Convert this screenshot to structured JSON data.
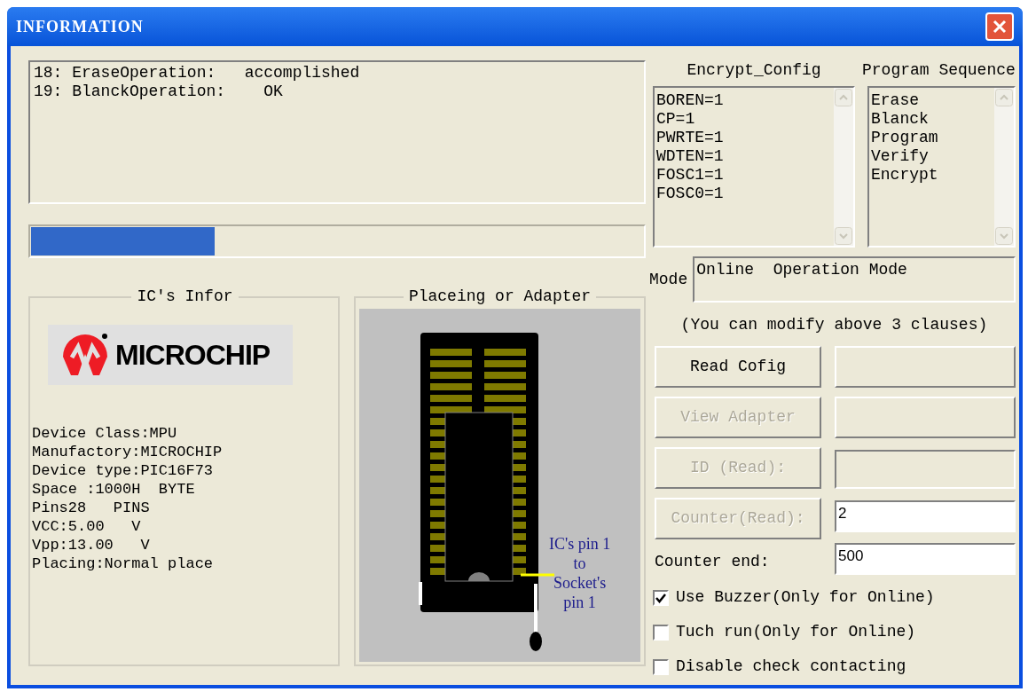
{
  "window": {
    "title": "INFORMATION"
  },
  "log": {
    "lines": [
      "18: EraseOperation:   accomplished",
      "19: BlanckOperation:    OK"
    ]
  },
  "progress": {
    "level": 0.3
  },
  "ic_info": {
    "title": "IC's Infor",
    "logo_text": "MICROCHIP",
    "lines": [
      "Device Class:MPU",
      "Manufactory:MICROCHIP",
      "Device type:PIC16F73",
      "Space :1000H  BYTE",
      "Pins28   PINS",
      "VCC:5.00   V",
      "Vpp:13.00   V",
      "Placing:Normal place"
    ]
  },
  "placing": {
    "title": "Placeing or Adapter",
    "pin_note": [
      "IC's pin 1",
      "to",
      "Socket's",
      "pin 1"
    ]
  },
  "encrypt_config": {
    "title": "Encrypt_Config",
    "items": [
      "BOREN=1",
      "CP=1",
      "PWRTE=1",
      "WDTEN=1",
      "FOSC1=1",
      "FOSC0=1"
    ]
  },
  "program_sequence": {
    "title": "Program Sequence",
    "items": [
      "Erase",
      "Blanck",
      "Program",
      "Verify",
      "Encrypt"
    ]
  },
  "mode": {
    "label": "Mode",
    "value": "Online  Operation Mode"
  },
  "note": "(You can modify above 3 clauses)",
  "actions": [
    {
      "label": "Read Cofig",
      "disabled": false,
      "right": {
        "kind": "button"
      }
    },
    {
      "label": "View Adapter",
      "disabled": true,
      "right": {
        "kind": "button"
      }
    },
    {
      "label": "ID (Read):",
      "disabled": true,
      "right": {
        "kind": "readonly"
      }
    },
    {
      "label": "Counter(Read):",
      "disabled": true,
      "right": {
        "kind": "field",
        "value": "2"
      }
    }
  ],
  "counter_end": {
    "label": "Counter end:",
    "value": "500"
  },
  "options": [
    {
      "label": "Use Buzzer(Only for Online)",
      "checked": true
    },
    {
      "label": "Tuch run(Only for Online)",
      "checked": false
    },
    {
      "label": "Disable check contacting",
      "checked": false
    }
  ]
}
